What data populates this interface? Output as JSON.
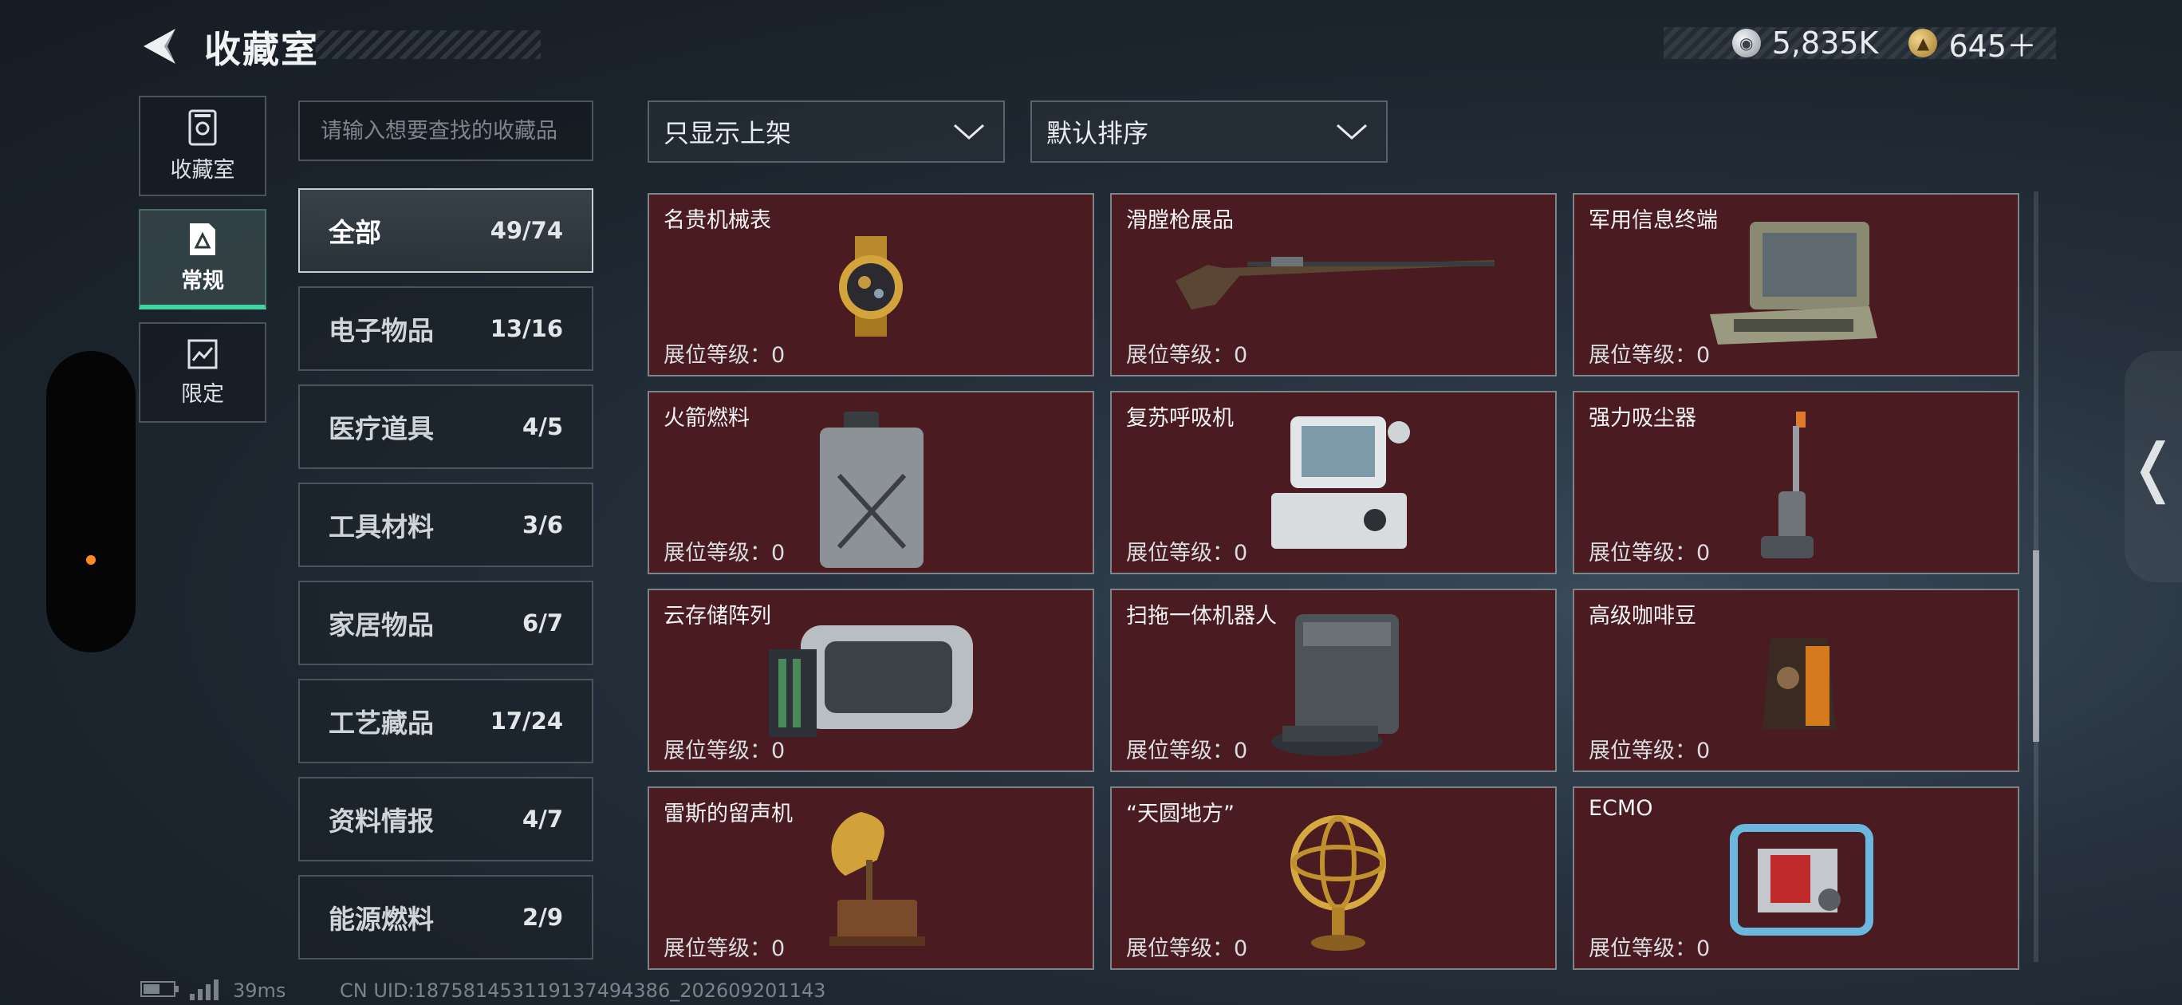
{
  "header": {
    "title": "收藏室",
    "currency": [
      {
        "icon": "silver-coin-icon",
        "value": "5,835K"
      },
      {
        "icon": "gold-coin-icon",
        "value": "645＋"
      }
    ]
  },
  "nav": [
    {
      "label": "收藏室",
      "icon": "trophy-icon"
    },
    {
      "label": "常规",
      "icon": "collection-icon",
      "active": true
    },
    {
      "label": "限定",
      "icon": "limited-icon"
    }
  ],
  "search": {
    "placeholder": "请输入想要查找的收藏品"
  },
  "filters": {
    "shelf": "只显示上架",
    "sort": "默认排序"
  },
  "categories": [
    {
      "name": "全部",
      "count": "49/74",
      "active": true
    },
    {
      "name": "电子物品",
      "count": "13/16"
    },
    {
      "name": "医疗道具",
      "count": "4/5"
    },
    {
      "name": "工具材料",
      "count": "3/6"
    },
    {
      "name": "家居物品",
      "count": "6/7"
    },
    {
      "name": "工艺藏品",
      "count": "17/24"
    },
    {
      "name": "资料情报",
      "count": "4/7"
    },
    {
      "name": "能源燃料",
      "count": "2/9"
    }
  ],
  "items": [
    {
      "name": "名贵机械表",
      "level": "展位等级：0",
      "art": "watch"
    },
    {
      "name": "滑膛枪展品",
      "level": "展位等级：0",
      "art": "musket"
    },
    {
      "name": "军用信息终端",
      "level": "展位等级：0",
      "art": "terminal"
    },
    {
      "name": "火箭燃料",
      "level": "展位等级：0",
      "art": "jerrycan"
    },
    {
      "name": "复苏呼吸机",
      "level": "展位等级：0",
      "art": "ventilator"
    },
    {
      "name": "强力吸尘器",
      "level": "展位等级：0",
      "art": "vacuum"
    },
    {
      "name": "云存储阵列",
      "level": "展位等级：0",
      "art": "storage"
    },
    {
      "name": "扫拖一体机器人",
      "level": "展位等级：0",
      "art": "robot"
    },
    {
      "name": "高级咖啡豆",
      "level": "展位等级：0",
      "art": "coffee"
    },
    {
      "name": "雷斯的留声机",
      "level": "展位等级：0",
      "art": "gramophone"
    },
    {
      "name": "“天圆地方”",
      "level": "展位等级：0",
      "art": "armillary"
    },
    {
      "name": "ECMO",
      "level": "展位等级：0",
      "art": "ecmo"
    }
  ],
  "footer": {
    "ping": "39ms",
    "uid": "CN UID:18758145311913749438​6_202609201143"
  },
  "colors": {
    "accent": "#3fd4a0",
    "card_bg": "#4a1b21",
    "dot": "#ff8a1e"
  }
}
